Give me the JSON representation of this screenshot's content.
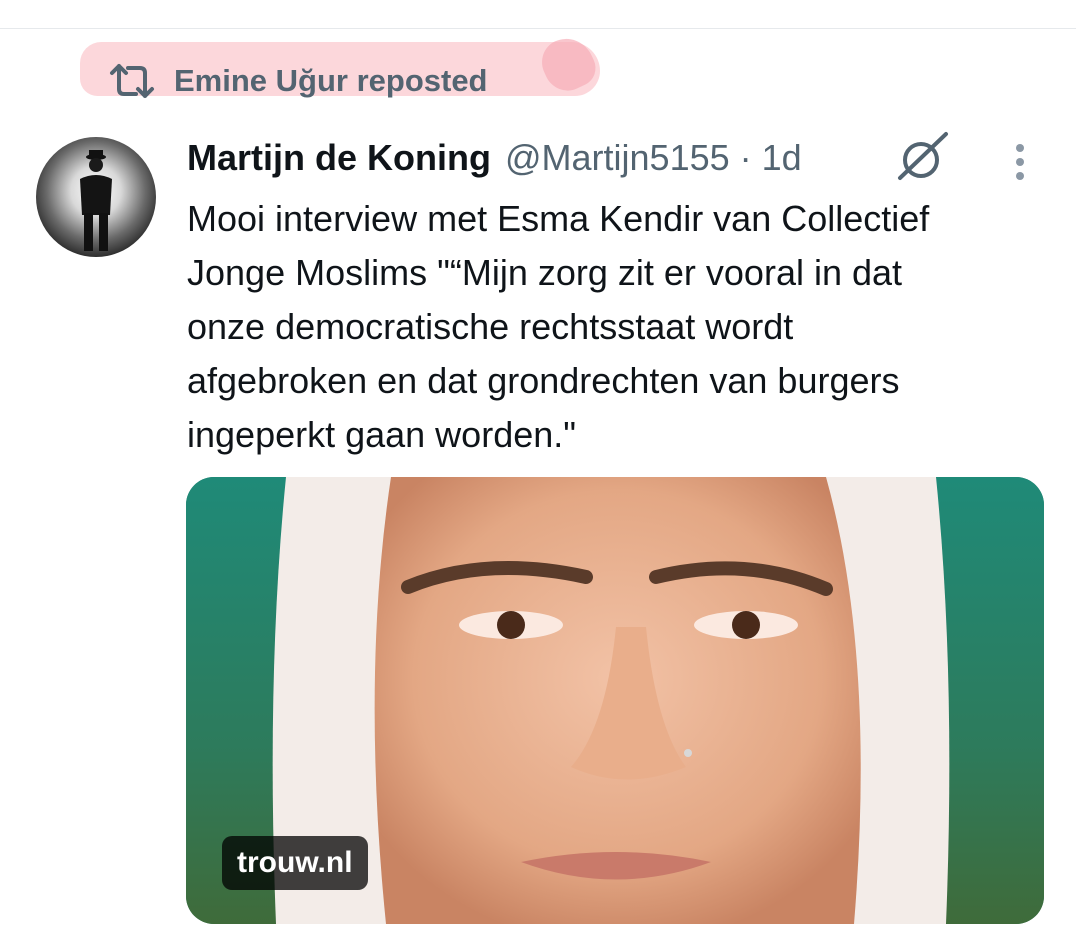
{
  "repost": {
    "icon": "repost-icon",
    "text": "Emine Uğur reposted"
  },
  "author": {
    "name": "Martijn de Koning",
    "handle": "@Martijn5155",
    "separator": "·",
    "time": "1d",
    "avatar_icon": "avatar"
  },
  "tweet": {
    "lines": [
      "Mooi interview met Esma Kendir van Collectief",
      "Jonge Moslims \"“Mijn zorg zit er vooral in dat",
      "onze democratische rechtsstaat wordt",
      "afgebroken en dat grondrechten van burgers",
      "ingeperkt gaan worden.\""
    ]
  },
  "media": {
    "source": "trouw.nl"
  },
  "icons": {
    "grok": "grok-icon",
    "more": "more-vertical-icon"
  },
  "colors": {
    "secondary_text": "#536471",
    "primary_text": "#0f1419",
    "highlight": "#fbd0d5"
  }
}
